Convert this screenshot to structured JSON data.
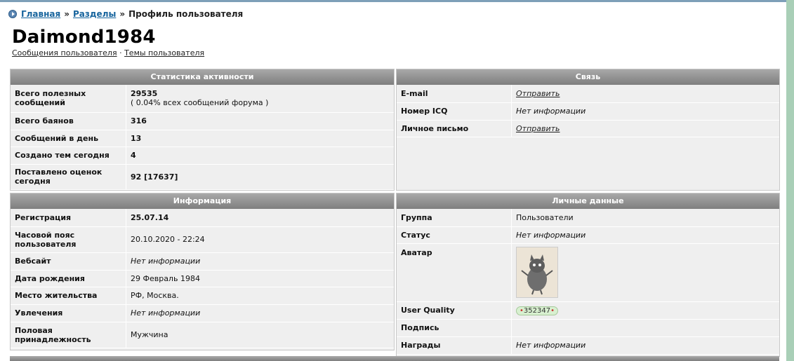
{
  "breadcrumb": {
    "home": "Главная",
    "sections": "Разделы",
    "current": "Профиль пользователя",
    "sep": "»"
  },
  "profile": {
    "username": "Daimond1984",
    "posts_link": "Сообщения пользователя",
    "dot": "·",
    "topics_link": "Темы пользователя"
  },
  "stats": {
    "title": "Статистика активности",
    "rows": [
      {
        "label": "Всего полезных сообщений",
        "value": "29535",
        "sub": "( 0.04% всех сообщений форума )"
      },
      {
        "label": "Всего баянов",
        "value": "316"
      },
      {
        "label": "Сообщений в день",
        "value": "13"
      },
      {
        "label": "Создано тем сегодня",
        "value": "4"
      },
      {
        "label": "Поставлено оценок сегодня",
        "value": "92 [17637]"
      }
    ]
  },
  "contact": {
    "title": "Связь",
    "rows": [
      {
        "label": "E-mail",
        "value": "Отправить"
      },
      {
        "label": "Номер ICQ",
        "value": "Нет информации"
      },
      {
        "label": "Личное письмо",
        "value": "Отправить"
      }
    ]
  },
  "info": {
    "title": "Информация",
    "rows": [
      {
        "label": "Регистрация",
        "value": "25.07.14"
      },
      {
        "label": "Часовой пояс пользователя",
        "value": "20.10.2020 - 22:24"
      },
      {
        "label": "Вебсайт",
        "value": "Нет информации"
      },
      {
        "label": "Дата рождения",
        "value": "29 Февраль 1984"
      },
      {
        "label": "Место жительства",
        "value": "РФ, Москва."
      },
      {
        "label": "Увлечения",
        "value": "Нет информации"
      },
      {
        "label": "Половая принадлежность",
        "value": "Мужчина"
      }
    ]
  },
  "personal": {
    "title": "Личные данные",
    "rows": [
      {
        "label": "Группа",
        "value": "Пользователи"
      },
      {
        "label": "Статус",
        "value": "Нет информации"
      },
      {
        "label": "Аватар",
        "value": ""
      },
      {
        "label": "User Quality",
        "value": "352347"
      },
      {
        "label": "Подпись",
        "value": ""
      },
      {
        "label": "Награды",
        "value": "Нет информации"
      }
    ]
  }
}
